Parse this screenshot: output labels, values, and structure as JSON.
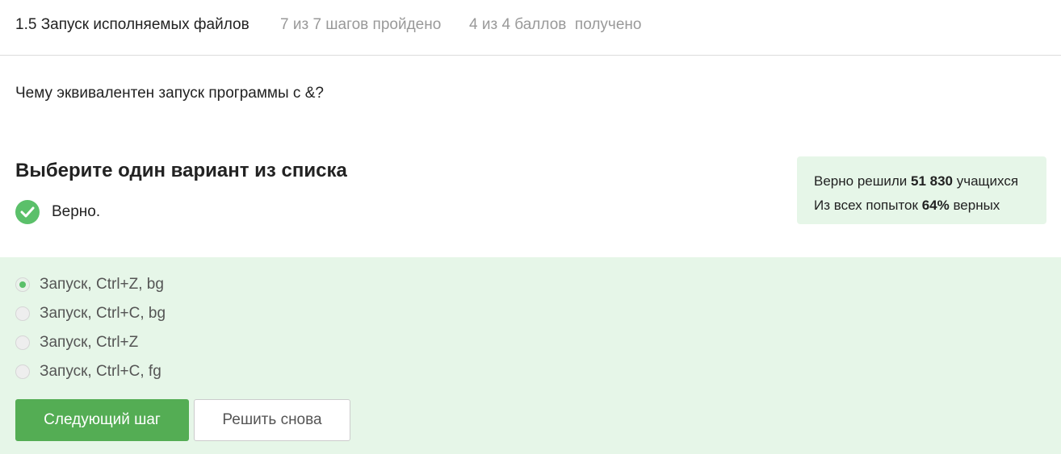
{
  "header": {
    "lesson_title": "1.5 Запуск исполняемых файлов",
    "steps_progress": "7 из 7 шагов пройдено",
    "points_progress": "4 из 4 баллов  получено"
  },
  "question": {
    "text": "Чему эквивалентен запуск программы с &?"
  },
  "quiz": {
    "heading": "Выберите один вариант из списка",
    "result_text": "Верно.",
    "result_icon": "check-circle-icon"
  },
  "stats": {
    "line1_prefix": "Верно решили ",
    "line1_count": "51 830",
    "line1_suffix": " учащихся",
    "line2_prefix": "Из всех попыток ",
    "line2_percent": "64%",
    "line2_suffix": " верных"
  },
  "options": [
    {
      "label": "Запуск, Ctrl+Z, bg",
      "selected": true
    },
    {
      "label": "Запуск, Ctrl+C, bg",
      "selected": false
    },
    {
      "label": "Запуск, Ctrl+Z",
      "selected": false
    },
    {
      "label": "Запуск, Ctrl+C, fg",
      "selected": false
    }
  ],
  "actions": {
    "next_label": "Следующий шаг",
    "retry_label": "Решить снова"
  },
  "colors": {
    "accent_green": "#54ad54",
    "success_green": "#5bc06a",
    "answer_background": "#e6f6e8"
  }
}
